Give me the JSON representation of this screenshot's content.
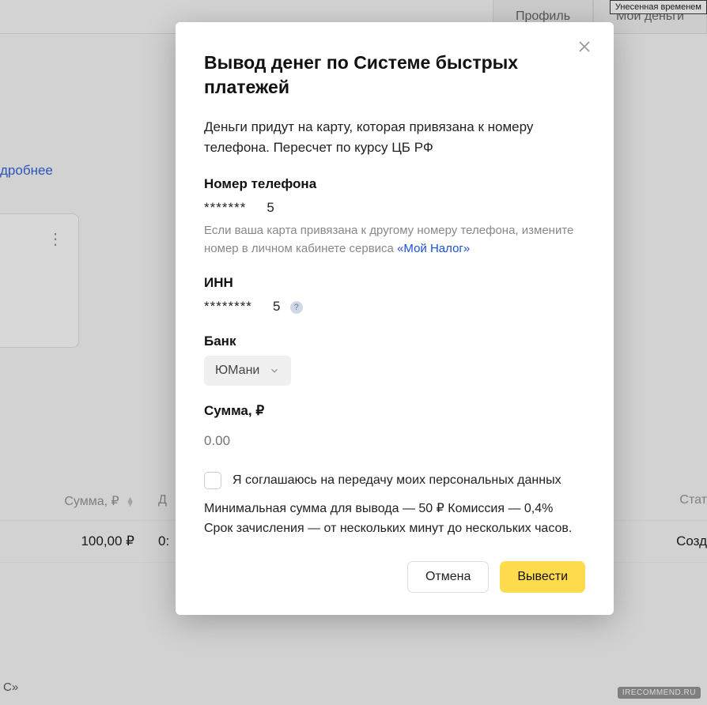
{
  "bg": {
    "tab_profile": "Профиль",
    "tab_money": "Мои деньги",
    "browser_tab": "Унесенная временем",
    "link_more": "дробнее",
    "kebab": "⋮",
    "table": {
      "col_sum": "Сумма, ₽",
      "col_date_partial": "Д",
      "col_status": "Стат",
      "row_sum": "100,00 ₽",
      "row_date_partial": "0:",
      "row_status": "Созд"
    },
    "footer_partial": "С»",
    "watermark": "IRECOMMEND.RU"
  },
  "modal": {
    "title": "Вывод денег по Системе быстрых платежей",
    "description": "Деньги придут на карту, которая привязана к номеру телефона. Пересчет по курсу ЦБ РФ",
    "phone": {
      "label": "Номер телефона",
      "masked": "*******",
      "tail": "5",
      "hint_pre": "Если ваша карта привязана к другому номеру телефона, измените номер в личном кабинете сервиса ",
      "hint_link": "«Мой Налог»"
    },
    "inn": {
      "label": "ИНН",
      "masked": "********",
      "tail": "5"
    },
    "bank": {
      "label": "Банк",
      "selected": "ЮМани"
    },
    "amount": {
      "label": "Сумма, ₽",
      "placeholder": "0.00"
    },
    "consent": "Я соглашаюсь на передачу моих персональных данных",
    "fineprint": "Минимальная сумма для вывода — 50 ₽ Комиссия — 0,4% Срок зачисления — от нескольких минут до нескольких часов.",
    "cancel": "Отмена",
    "submit": "Вывести"
  }
}
